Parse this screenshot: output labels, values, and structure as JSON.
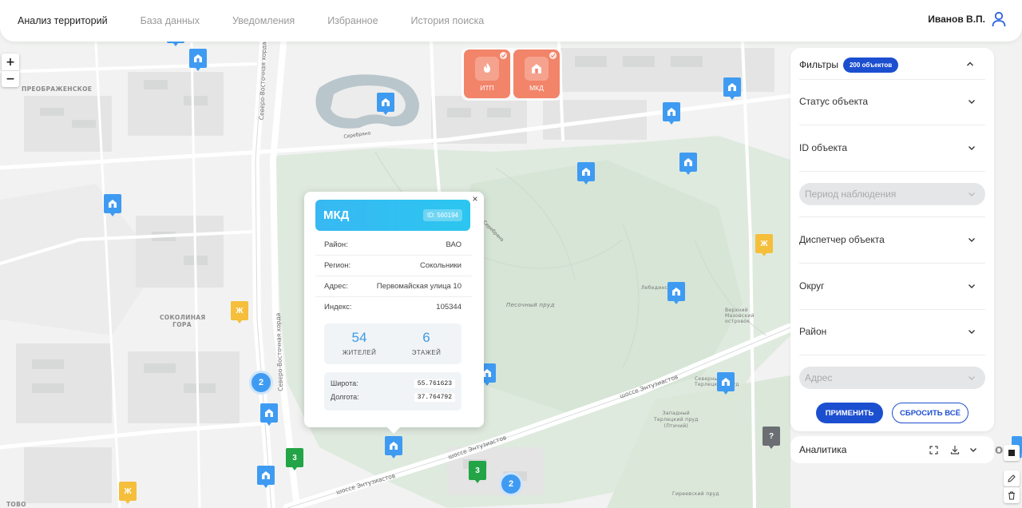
{
  "header": {
    "nav": [
      {
        "label": "Анализ территорий",
        "active": true
      },
      {
        "label": "База данных",
        "active": false
      },
      {
        "label": "Уведомления",
        "active": false
      },
      {
        "label": "Избранное",
        "active": false
      },
      {
        "label": "История поиска",
        "active": false
      }
    ],
    "user_name": "Иванов В.П."
  },
  "zoom": {
    "plus": "+",
    "minus": "−"
  },
  "category_chips": [
    {
      "label": "ИТП",
      "icon": "fire-icon"
    },
    {
      "label": "МКД",
      "icon": "house-icon"
    }
  ],
  "popup": {
    "title": "МКД",
    "id_badge": "ID: 560194",
    "close": "×",
    "rows": [
      {
        "label": "Район:",
        "value": "ВАО"
      },
      {
        "label": "Регион:",
        "value": "Сокольники"
      },
      {
        "label": "Адрес:",
        "value": "Первомайская улица 10"
      },
      {
        "label": "Индекс:",
        "value": "105344"
      }
    ],
    "stats": [
      {
        "value": "54",
        "label": "ЖИТЕЛЕЙ"
      },
      {
        "value": "6",
        "label": "ЭТАЖЕЙ"
      }
    ],
    "coords": [
      {
        "label": "Широта:",
        "value": "55.761623"
      },
      {
        "label": "Долгота:",
        "value": "37.764792"
      }
    ]
  },
  "filters": {
    "title": "Фильтры",
    "badge": "200 объектов",
    "items": [
      {
        "label": "Статус объекта",
        "disabled": false
      },
      {
        "label": "ID объекта",
        "disabled": false
      },
      {
        "label": "Период наблюдения",
        "disabled": true
      },
      {
        "label": "Диспетчер объекта",
        "disabled": false
      },
      {
        "label": "Округ",
        "disabled": false
      },
      {
        "label": "Район",
        "disabled": false
      },
      {
        "label": "Адрес",
        "disabled": true
      }
    ],
    "apply_label": "ПРИМЕНИТЬ",
    "reset_label": "СБРОСИТЬ ВСЁ"
  },
  "analytics": {
    "title": "Аналитика"
  },
  "map": {
    "labels": [
      {
        "text": "ПРЕОБРАЖЕНСКОЕ"
      },
      {
        "text": "СОКОЛИНАЯ\nГОРА"
      },
      {
        "text": "Лебединский"
      },
      {
        "text": "Песочный пруд"
      },
      {
        "text": "Верхний\nМазовский\nостровок"
      },
      {
        "text": "Северный\nТерлецкий пруд"
      },
      {
        "text": "Западный\nТерлецкий пруд\n(Птичий)"
      },
      {
        "text": "Гиреевский пруд"
      },
      {
        "text": "ТОВО"
      },
      {
        "text": "ОВ"
      }
    ],
    "roads": [
      {
        "text": "Северо-Восточная хорда"
      },
      {
        "text": "Северо-Восточная хорда"
      },
      {
        "text": "шоссе Энтузиастов"
      },
      {
        "text": "шоссе Энтузиастов"
      },
      {
        "text": "шоссе Энтузиастов"
      },
      {
        "text": "Серебряно"
      },
      {
        "text": "Серебряно"
      }
    ],
    "clusters": [
      "2",
      "2"
    ],
    "markers_green": [
      "3",
      "3"
    ],
    "markers_yellow": [
      "Ж",
      "Ж",
      "Ж"
    ],
    "marker_gray": "?",
    "colors": {
      "house_pin": "#3f9bf2",
      "yellow_pin": "#f5bf3c",
      "green_pin": "#22a447",
      "gray_pin": "#6b6e72",
      "chip": "#f28469",
      "accent": "#1c4fd0"
    }
  }
}
